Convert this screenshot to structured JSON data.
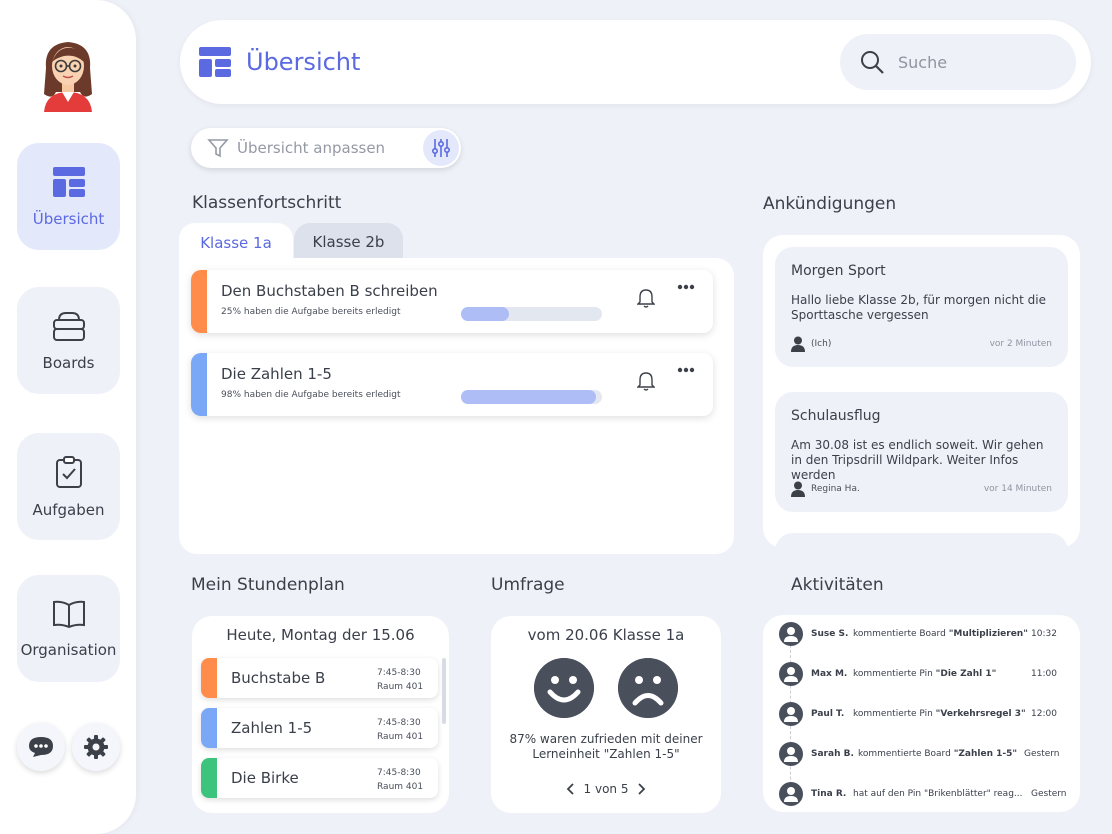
{
  "sidebar": {
    "nav": [
      {
        "label": "Übersicht",
        "icon": "dashboard-icon"
      },
      {
        "label": "Boards",
        "icon": "boards-icon"
      },
      {
        "label": "Aufgaben",
        "icon": "clipboard-check-icon"
      },
      {
        "label": "Organisation",
        "icon": "book-icon"
      }
    ],
    "bottom": [
      {
        "icon": "chat-icon"
      },
      {
        "icon": "settings-gear-icon"
      }
    ]
  },
  "header": {
    "title": "Übersicht",
    "search_placeholder": "Suche"
  },
  "filter": {
    "placeholder": "Übersicht anpassen"
  },
  "progress": {
    "title": "Klassenfortschritt",
    "tabs": [
      "Klasse 1a",
      "Klasse 2b"
    ],
    "tasks": [
      {
        "name": "Den Buchstaben B schreiben",
        "sub": "25% haben die Aufgabe bereits erledigt",
        "percent": 0.34,
        "color": "#ff8c4a"
      },
      {
        "name": "Die Zahlen 1-5",
        "sub": "98% haben die Aufgabe bereits erledigt",
        "percent": 0.96,
        "color": "#7ba7f7"
      }
    ]
  },
  "announcements": {
    "title": "Ankündigungen",
    "items": [
      {
        "title": "Morgen Sport",
        "body": "Hallo liebe Klasse 2b, für morgen nicht die Sporttasche vergessen",
        "author": "(Ich)",
        "time": "vor 2 Minuten"
      },
      {
        "title": "Schulausflug",
        "body": "Am 30.08 ist es endlich soweit. Wir gehen in den Tripsdrill Wildpark. Weiter Infos werden",
        "author": "Regina Ha.",
        "time": "vor 14 Minuten"
      }
    ]
  },
  "schedule": {
    "title": "Mein Stundenplan",
    "day": "Heute, Montag der 15.06",
    "lessons": [
      {
        "name": "Buchstabe B",
        "time": "7:45-8:30",
        "room": "Raum 401",
        "color": "#ff8c4a"
      },
      {
        "name": "Zahlen 1-5",
        "time": "7:45-8:30",
        "room": "Raum 401",
        "color": "#7ba7f7"
      },
      {
        "name": "Die Birke",
        "time": "7:45-8:30",
        "room": "Raum 401",
        "color": "#3cc47c"
      }
    ]
  },
  "survey": {
    "title": "Umfrage",
    "header": "vom 20.06 Klasse 1a",
    "result": "87% waren zufrieden mit deiner Lerneinheit \"Zahlen 1-5\"",
    "pager": "1 von 5"
  },
  "activities": {
    "title": "Aktivitäten",
    "items": [
      {
        "name": "Suse S.",
        "action": "kommentierte Board ",
        "target": "\"Multiplizieren\"",
        "time": "10:32"
      },
      {
        "name": "Max M.",
        "action": "kommentierte Pin ",
        "target": "\"Die Zahl 1\"",
        "time": "11:00"
      },
      {
        "name": "Paul T.",
        "action": "kommentierte Pin ",
        "target": "\"Verkehrsregel 3\"",
        "time": "12:00"
      },
      {
        "name": "Sarah B.",
        "action": "kommentierte Board ",
        "target": "\"Zahlen 1-5\"",
        "time": "Gestern"
      },
      {
        "name": "Tina R.",
        "action": "hat auf den Pin ",
        "target": "\"Brikenblätter\" reag...",
        "time": "Gestern"
      }
    ]
  },
  "colors": {
    "accent": "#5b6ae0",
    "background": "#eef1f8",
    "orange": "#ff8c4a",
    "blue": "#7ba7f7",
    "green": "#3cc47c"
  }
}
